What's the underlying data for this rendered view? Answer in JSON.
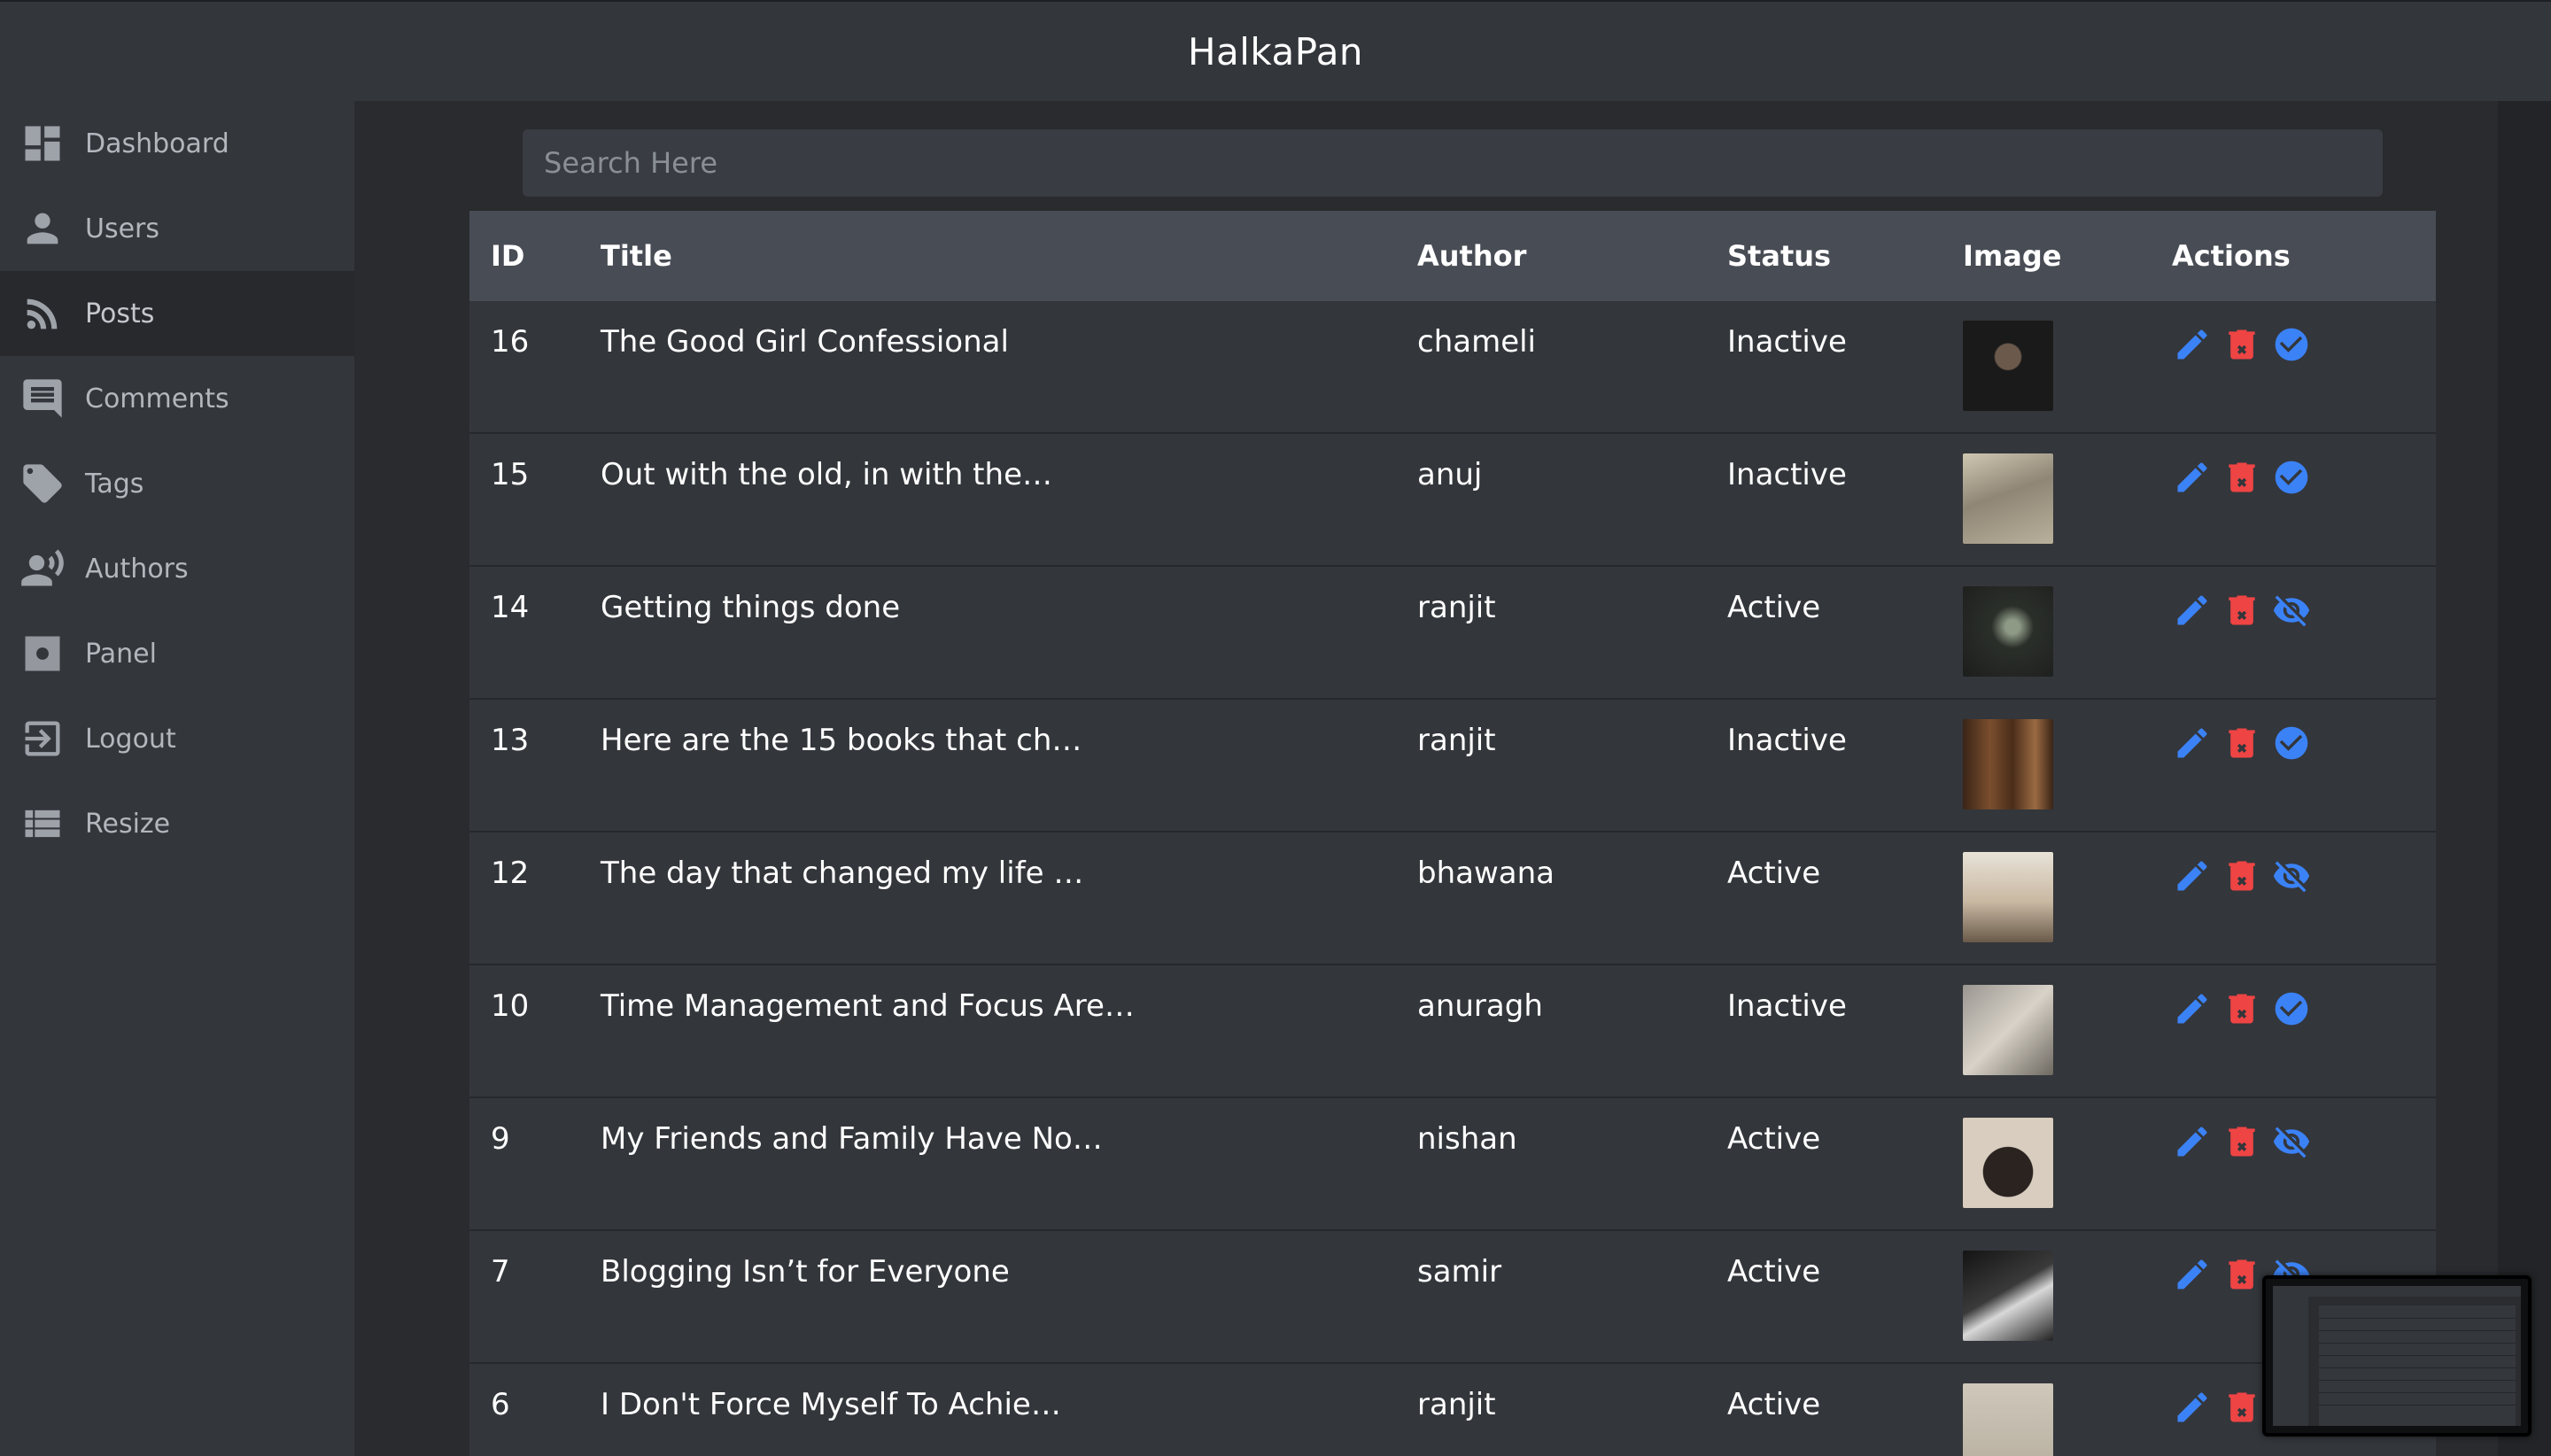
{
  "app": {
    "title": "HalkaPan"
  },
  "sidebar": {
    "items": [
      {
        "label": "Dashboard",
        "icon": "dashboard-icon",
        "active": false
      },
      {
        "label": "Users",
        "icon": "user-icon",
        "active": false
      },
      {
        "label": "Posts",
        "icon": "rss-icon",
        "active": true
      },
      {
        "label": "Comments",
        "icon": "comment-icon",
        "active": false
      },
      {
        "label": "Tags",
        "icon": "tag-icon",
        "active": false
      },
      {
        "label": "Authors",
        "icon": "speaking-person-icon",
        "active": false
      },
      {
        "label": "Panel",
        "icon": "gear-icon",
        "active": false
      },
      {
        "label": "Logout",
        "icon": "logout-icon",
        "active": false
      },
      {
        "label": "Resize",
        "icon": "list-icon",
        "active": false
      }
    ]
  },
  "search": {
    "placeholder": "Search Here",
    "value": ""
  },
  "table": {
    "headers": {
      "id": "ID",
      "title": "Title",
      "author": "Author",
      "status": "Status",
      "image": "Image",
      "actions": "Actions"
    },
    "rows": [
      {
        "id": "16",
        "title": "The Good Girl Confessional",
        "author": "chameli",
        "status": "Inactive",
        "toggle": "publish-check-icon",
        "thumb": "woman-veil-photo"
      },
      {
        "id": "15",
        "title": "Out with the old, in with the…",
        "author": "anuj",
        "status": "Inactive",
        "toggle": "publish-check-icon",
        "thumb": "newspaper-photo"
      },
      {
        "id": "14",
        "title": "Getting things done",
        "author": "ranjit",
        "status": "Active",
        "toggle": "hide-eye-icon",
        "thumb": "seedling-hands-photo"
      },
      {
        "id": "13",
        "title": "Here are the 15 books that ch…",
        "author": "ranjit",
        "status": "Inactive",
        "toggle": "publish-check-icon",
        "thumb": "old-books-photo"
      },
      {
        "id": "12",
        "title": "The day that changed my life …",
        "author": "bhawana",
        "status": "Active",
        "toggle": "hide-eye-icon",
        "thumb": "couple-kitchen-photo"
      },
      {
        "id": "10",
        "title": "Time Management and Focus Are…",
        "author": "anuragh",
        "status": "Inactive",
        "toggle": "publish-check-icon",
        "thumb": "writing-desk-photo"
      },
      {
        "id": "9",
        "title": "My Friends and Family Have No…",
        "author": "nishan",
        "status": "Active",
        "toggle": "hide-eye-icon",
        "thumb": "family-photo"
      },
      {
        "id": "7",
        "title": "Blogging Isn’t for Everyone",
        "author": "samir",
        "status": "Active",
        "toggle": "hide-eye-icon",
        "thumb": "laptop-typing-photo"
      },
      {
        "id": "6",
        "title": "I Don't Force Myself To Achie…",
        "author": "ranjit",
        "status": "Active",
        "toggle": "hide-eye-icon",
        "thumb": "score-paper-photo"
      }
    ]
  },
  "colors": {
    "accent_blue": "#3b82f6",
    "delete_red": "#ef4444",
    "sidebar_bg": "#33363b",
    "header_bg": "#484c54"
  }
}
